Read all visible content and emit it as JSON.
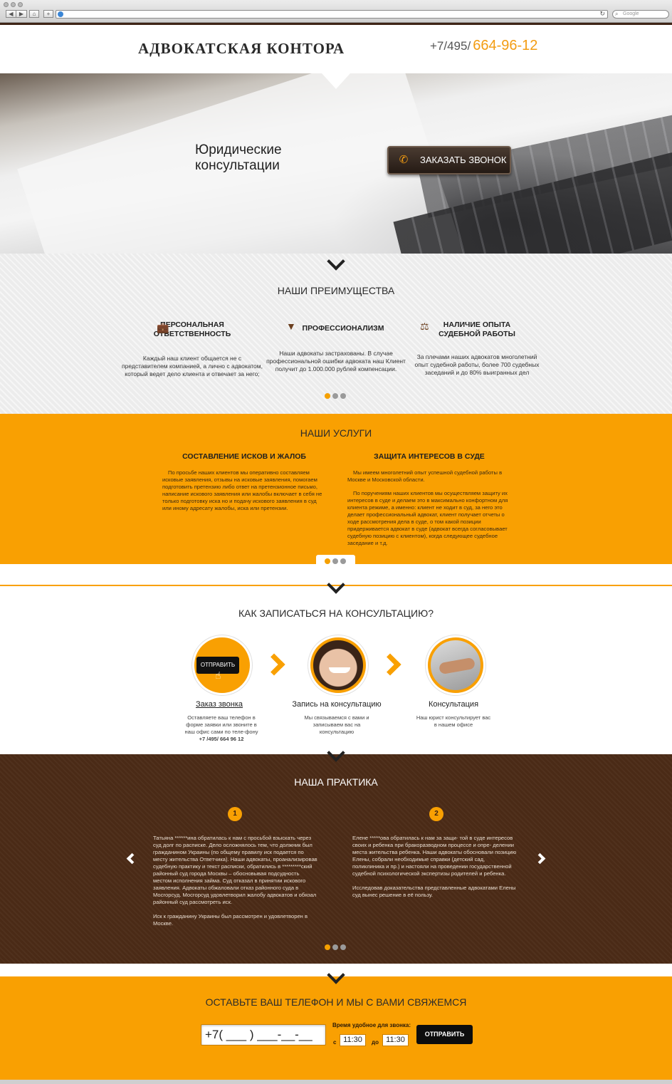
{
  "browser": {
    "back": "◀",
    "forward": "▶",
    "home": "⌂",
    "add": "+",
    "search_placeholder": "Google"
  },
  "header": {
    "logo": "АДВОКАТСКАЯ КОНТОРА",
    "phone_prefix": "+7/495/",
    "phone_number": "664-96-12"
  },
  "hero": {
    "title_line1": "Юридические",
    "title_line2": "консультации",
    "button": "ЗАКАЗАТЬ ЗВОНОК"
  },
  "advantages": {
    "title": "НАШИ ПРЕИМУЩЕСТВА",
    "items": [
      {
        "head1": "ПЕРСОНАЛЬНАЯ",
        "head2": "ОТВЕТСТВЕННОСТЬ",
        "icon": "briefcase-icon",
        "text": "Каждый наш клиент общается не с представителем компанией, а лично с адвокатом, который ведет дело клиента и отвечает за него;"
      },
      {
        "head1": "ПРОФЕССИОНАЛИЗМ",
        "head2": "",
        "icon": "tie-icon",
        "text": "Наши адвокаты застрахованы. В случае профессиональной ошибки адвоката наш Клиент получит до 1.000.000 рублей компенсации."
      },
      {
        "head1": "НАЛИЧИЕ ОПЫТА",
        "head2": "СУДЕБНОЙ РАБОТЫ",
        "icon": "gavel-icon",
        "text": "За плечами наших адвокатов многолетний опыт судебной работы, более 700 судебных заседаний и до 80% выигранных дел"
      }
    ]
  },
  "services": {
    "title": "НАШИ УСЛУГИ",
    "cols": [
      {
        "head": "СОСТАВЛЕНИЕ ИСКОВ И ЖАЛОБ",
        "p1": "По просьбе наших клиентов мы оперативно составляем исковые заявления, отзывы на исковые заявления, помогаем подготовить претензию либо ответ на претензионное письмо, написание искового заявления или жалобы включает в себя не только подготовку иска но и подачу искового заявления в суд или иному адресату жалобы, иска или претензии.",
        "p2": ""
      },
      {
        "head": "ЗАЩИТА ИНТЕРЕСОВ В СУДЕ",
        "p1": "Мы имеем многолетний опыт успешной судебной работы в Москве и Московской области.",
        "p2": "По поручениям наших клиентов мы осуществляем защиту их интересов в суде и делаем это в максимально конфортном для клиента режиме, а именно: клиент не ходит в суд, за него это делает профессиональный адвокат, клиент получает отчеты о ходе рассмотрения дела в суде, о том какой позиции придерживается адвокат в суде (адвокат всегда согласовывает судебную позицию с клиентом), когда следующее судебное заседание и т.д."
      }
    ]
  },
  "steps": {
    "title": "КАК ЗАПИСАТЬСЯ НА КОНСУЛЬТАЦИЮ?",
    "send_chip": "ОТПРАВИТЬ",
    "items": [
      {
        "title": "Заказ звонка",
        "text": "Оставляете ваш телефон в форме заявки или звоните в наш офис сами по теле-фону",
        "phone": "+7 /495/ 664 96 12"
      },
      {
        "title": "Запись на консультацию",
        "text": "Мы связываемся с вами и записываем вас на консультацию",
        "phone": ""
      },
      {
        "title": "Консультация",
        "text": "Наш юрист консультирует вас в нашем офисе",
        "phone": ""
      }
    ]
  },
  "practice": {
    "title": "НАША ПРАКТИКА",
    "cases": [
      {
        "num": "1",
        "p1": "Татьяна ******ина обратилась к нам с просьбой взыскать через суд долг по расписке. Дело осложнялось тем, что должник был гражданином Украины (по общему правилу иск подается по месту жительства Ответчика). Наши адвокаты, проанализировав судебную практику и текст расписки, обратились в *********ский районный суд города Москвы – обосновывая подсудность местом исполнения займа. Суд отказал в принятии искового заявления. Адвокаты обжаловали отказ районного суда в Мосгорсуд. Мосгорсуд удовлетворил жалобу адвокатов и обязал районный суд рассмотреть иск.",
        "p2": "Иск к гражданину Украины был рассмотрен и удовлетворен в Москве."
      },
      {
        "num": "2",
        "p1": "Елене *****ова обратилась к нам за защи- той в суде интересов своих и ребенка при бракоразводном процессе и опре- делении места жительства ребенка. Наши адвокаты обосновали позицию Елены, собрали необходимые справки (детский сад, поликлиника и пр.) и настояли на проведении государственной судебной психологической экспертизы родителей и ребенка.",
        "p2": "Исследовав доказательства представленные адвокатами Елены суд вынес решение в её пользу."
      }
    ]
  },
  "contact": {
    "title": "ОСТАВЬТЕ ВАШ ТЕЛЕФОН И МЫ С ВАМИ СВЯЖЕМСЯ",
    "phone_mask": "+7( ___ ) ___-__-__",
    "time_label": "Время удобное для звонка:",
    "from_label": "с",
    "from_value": "11:30",
    "to_label": "до",
    "to_value": "11:30",
    "submit": "ОТПРАВИТЬ"
  },
  "colors": {
    "accent": "#f9a002",
    "brown": "#4a2a16",
    "dark": "#0d0d0d"
  }
}
